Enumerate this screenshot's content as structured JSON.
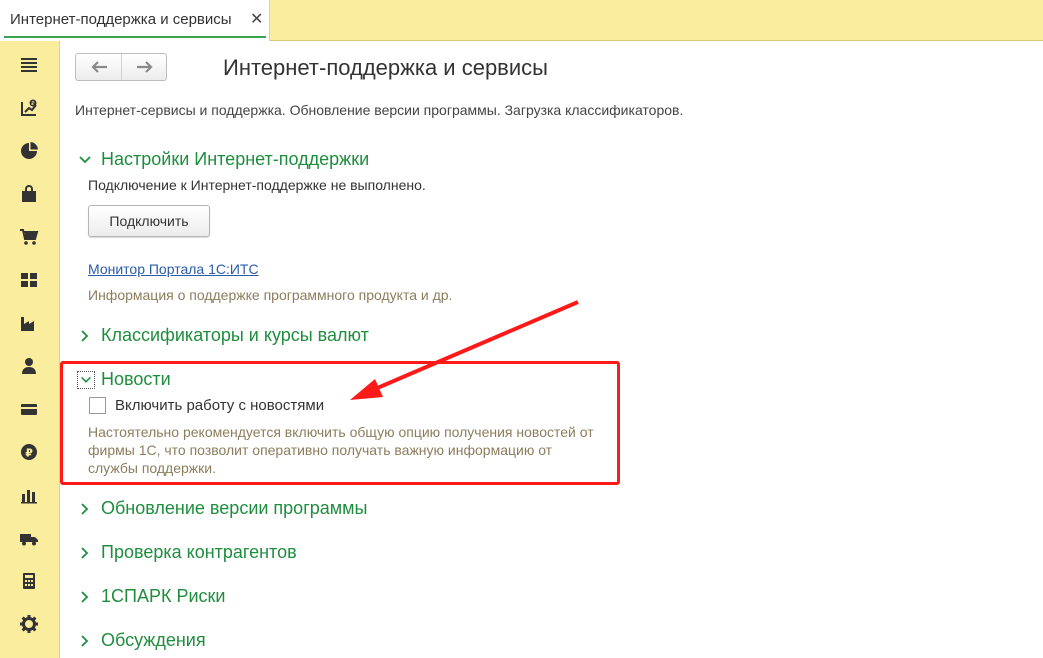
{
  "tab": {
    "title": "Интернет-поддержка и сервисы",
    "close": "✕"
  },
  "sidebar": {
    "items": [
      {
        "icon": "menu-icon"
      },
      {
        "icon": "bank-cash-icon"
      },
      {
        "icon": "pie-chart-icon"
      },
      {
        "icon": "purchases-bag-icon"
      },
      {
        "icon": "cart-icon"
      },
      {
        "icon": "warehouse-grid-icon"
      },
      {
        "icon": "factory-icon"
      },
      {
        "icon": "employees-icon"
      },
      {
        "icon": "card-icon"
      },
      {
        "icon": "ruble-icon"
      },
      {
        "icon": "bar-chart-icon"
      },
      {
        "icon": "truck-icon"
      },
      {
        "icon": "calculator-icon"
      },
      {
        "icon": "gear-icon"
      }
    ]
  },
  "page": {
    "title": "Интернет-поддержка и сервисы",
    "description": "Интернет-сервисы и поддержка. Обновление версии программы. Загрузка классификаторов."
  },
  "sections": {
    "support": {
      "title": "Настройки Интернет-поддержки",
      "status": "Подключение к Интернет-поддержке не выполнено.",
      "connect_button": "Подключить",
      "monitor_link": "Монитор Портала 1С:ИТС",
      "monitor_hint": "Информация о поддержке программного продукта и др."
    },
    "classifiers": {
      "title": "Классификаторы и курсы валют"
    },
    "news": {
      "title": "Новости",
      "checkbox_label": "Включить работу с новостями",
      "checked": false,
      "hint": "Настоятельно рекомендуется включить общую опцию получения новостей от фирмы 1С, что позволит оперативно получать важную информацию от службы поддержки."
    },
    "update": {
      "title": "Обновление версии программы"
    },
    "contractors": {
      "title": "Проверка контрагентов"
    },
    "spark": {
      "title": "1СПАРК Риски"
    },
    "discussions": {
      "title": "Обсуждения"
    }
  },
  "colors": {
    "accent_green": "#1e8e3e",
    "sidebar_bg": "#fbed9e",
    "annotation_red": "#ff1a1a",
    "link_blue": "#2a5caa",
    "hint_brown": "#8c7d5c"
  }
}
